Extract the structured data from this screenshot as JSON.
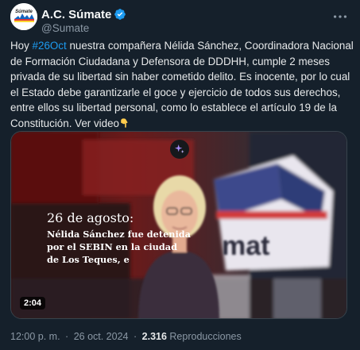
{
  "author": {
    "display_name": "A.C. Súmate",
    "handle": "@Sumate",
    "avatar_wordmark": "Súmate"
  },
  "tweet": {
    "lines": [
      {
        "pre": "Hoy ",
        "hashtag": "#26Oct",
        "post": " nuestra compañera Nélida Sánchez, Coordinadora Nacional"
      },
      {
        "text": "de Formación Ciudadana y Defensora de DDDHH, cumple 2 meses"
      },
      {
        "text": "privada de su libertad sin haber cometido delito. Es inocente, por lo cual"
      },
      {
        "text": "el Estado debe garantizarle el goce y ejercicio de todos sus derechos,"
      },
      {
        "text": "entre ellos su libertad personal, como lo establece el artículo 19 de la"
      },
      {
        "text": "Constitución. Ver video"
      }
    ],
    "emoji": "point-down-emoji"
  },
  "media": {
    "overlay_date": "26 de agosto:",
    "overlay_lines": [
      "Nélida Sánchez fue detenida",
      "por el SEBIN en la ciudad",
      "de Los Teques, e"
    ],
    "backdrop_text": "mat",
    "duration": "2:04"
  },
  "meta": {
    "time": "12:00 p. m.",
    "separator": "·",
    "date": "26 oct. 2024",
    "views_count": "2.316",
    "views_label": "Reproducciones"
  },
  "colors": {
    "background": "#15202b",
    "accent": "#1d9bf0",
    "text": "#e7e9ea",
    "muted": "#8b98a5"
  },
  "icons": [
    "verified-badge-icon",
    "more-options-icon",
    "sparkle-icon",
    "point-down-emoji"
  ]
}
